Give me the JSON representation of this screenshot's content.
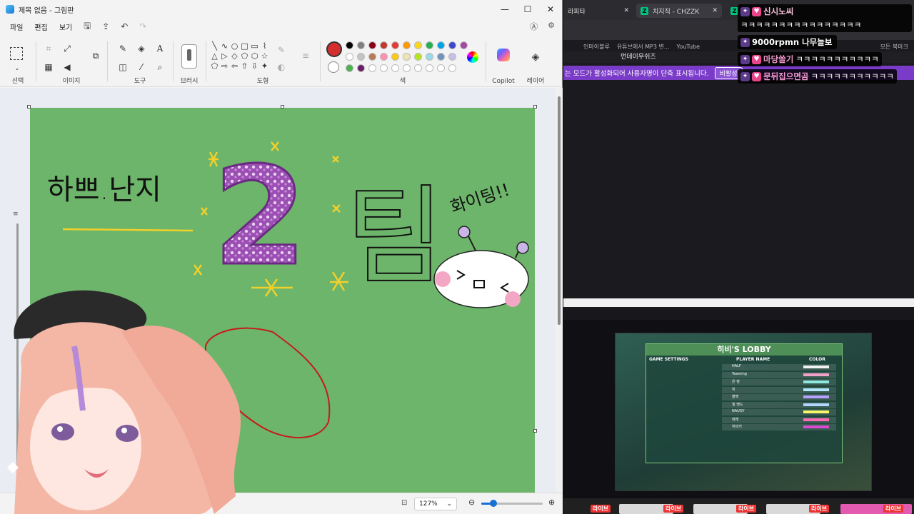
{
  "paint": {
    "title": "제목 없음 - 그림판",
    "menu": [
      "파일",
      "편집",
      "보기"
    ],
    "groups": {
      "select": "선택",
      "image": "이미지",
      "tools": "도구",
      "brush": "브러시",
      "shapes": "도형",
      "color": "색",
      "copilot": "Copilot",
      "layers": "레이어"
    },
    "colors": {
      "primary": "#d32f2f",
      "secondary": "#ffffff",
      "palette_row1": [
        "#000000",
        "#7f7f7f",
        "#880015",
        "#c0392b",
        "#e53935",
        "#ff9800",
        "#f9d71c",
        "#22b14c",
        "#00a2e8",
        "#3f48cc",
        "#a349a4"
      ],
      "palette_row2": [
        "#ffffff",
        "#c3c3c3",
        "#b97a57",
        "#ff8fb2",
        "#ffc90e",
        "#efe4b0",
        "#b5e61d",
        "#99d9ea",
        "#7092be",
        "#c8bfe7"
      ],
      "palette_row3": [
        "#4caf50",
        "#6a1b6a",
        "#ffffff",
        "#ffffff",
        "#ffffff",
        "#ffffff",
        "#ffffff",
        "#ffffff",
        "#ffffff",
        "#ffffff"
      ]
    },
    "canvas_bg": "#6db56a",
    "drawing": {
      "left_text": "하쁘.난지",
      "big_number": "2",
      "right_text": "팀",
      "fighting": "화이팅!!"
    },
    "zoom": "127%",
    "zoom_fraction": 0.2
  },
  "browser": {
    "tabs": [
      {
        "label": "라피타"
      },
      {
        "label": "치지직 - CHZZK"
      }
    ],
    "bookmarks": [
      "인마이블루",
      "유튜브에서 MP3 변...",
      "YouTube",
      "모든 북마크"
    ],
    "popup_title": "먼데이우쉬즈",
    "notice_text": "는 모드가 활성화되어 사용자명이 단축 표시됩니다.",
    "notice_button": "비활성",
    "lobby": {
      "title": "히비'S LOBBY",
      "col_settings": "GAME SETTINGS",
      "col_player": "PLAYER NAME",
      "col_color": "COLOR",
      "players": [
        "HALF",
        "Teaming",
        "은 정",
        "히",
        "블랙",
        "칠 앤드",
        "NAUGY",
        "레레",
        "히비키"
      ],
      "player_colors": [
        "#f2f2f2",
        "#f2a2c8",
        "#8ee8e0",
        "#b1e6ff",
        "#b8a0ff",
        "#b4d5ff",
        "#f7f76a",
        "#ff6bb5",
        "#d94bd0"
      ]
    },
    "live_label": "라이브"
  },
  "chat": [
    {
      "nick": "신시노씨",
      "msg": "ㅋㅋㅋㅋㅋㅋㅋㅋㅋㅋㅋㅋㅋㅋㅋㅋ",
      "nick_color": "#ffc6e0"
    },
    {
      "nick": "9000rpmn 나무늘보",
      "msg": "",
      "nick_color": "#ffffff"
    },
    {
      "nick": "마당쓸기",
      "msg": "ㅋㅋㅋㅋㅋㅋㅋㅋㅋㅋㅋ",
      "nick_color": "#f49bd0"
    },
    {
      "nick": "문뒤집으면곰",
      "msg": "ㅋㅋㅋㅋㅋㅋㅋㅋㅋㅋㅋ",
      "nick_color": "#f49bd0"
    }
  ]
}
